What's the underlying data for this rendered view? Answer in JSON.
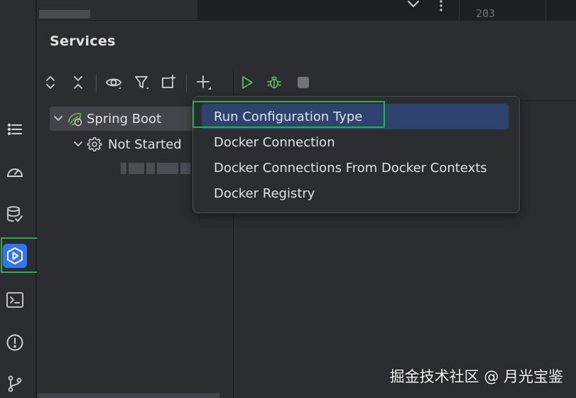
{
  "editor": {
    "line_number": "203"
  },
  "services": {
    "title": "Services",
    "tree": [
      {
        "label": "Spring Boot",
        "icon": "spring-boot-icon",
        "expanded": true
      },
      {
        "label": "Not Started",
        "icon": "gear-icon",
        "expanded": true
      }
    ]
  },
  "popup_menu": {
    "items": [
      {
        "label": "Run Configuration Type",
        "selected": true
      },
      {
        "label": "Docker Connection",
        "selected": false
      },
      {
        "label": "Docker Connections From Docker Contexts",
        "selected": false
      },
      {
        "label": "Docker Registry",
        "selected": false
      }
    ]
  },
  "watermark": "掘金技术社区 @ 月光宝鉴",
  "colors": {
    "background": "#1e1f22",
    "panel": "#2b2d30",
    "accent": "#3574f0",
    "selection": "#2e436e",
    "run_green": "#5fb85f",
    "highlight_box": "#22b14c"
  }
}
